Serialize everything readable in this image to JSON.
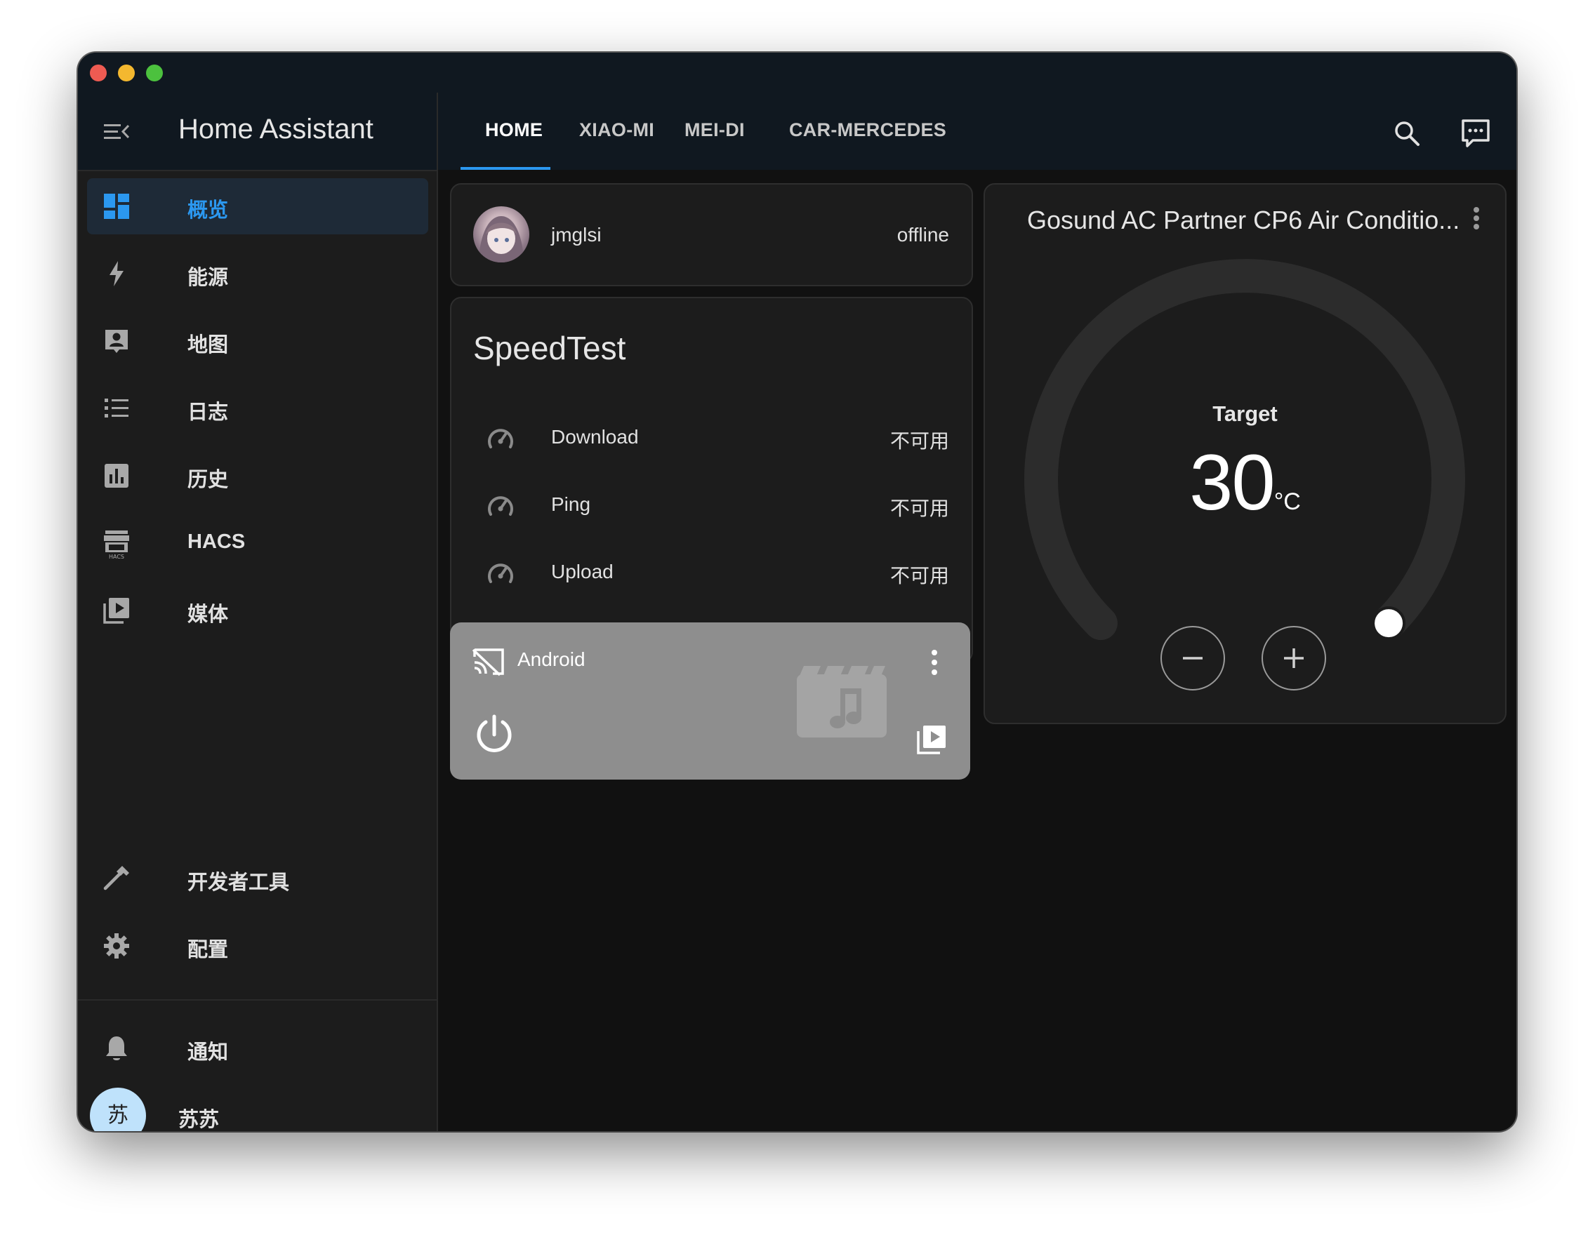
{
  "app": {
    "title": "Home Assistant"
  },
  "sidebar": {
    "items": [
      {
        "label": "概览",
        "icon": "view-dashboard-icon",
        "active": true
      },
      {
        "label": "能源",
        "icon": "lightning-bolt-icon"
      },
      {
        "label": "地图",
        "icon": "account-box-icon"
      },
      {
        "label": "日志",
        "icon": "format-list-bulleted-icon"
      },
      {
        "label": "历史",
        "icon": "chart-box-icon"
      },
      {
        "label": "HACS",
        "icon": "hacs-store-icon"
      },
      {
        "label": "媒体",
        "icon": "play-box-multiple-icon"
      }
    ],
    "bottom_items": [
      {
        "label": "开发者工具",
        "icon": "hammer-icon"
      },
      {
        "label": "配置",
        "icon": "cog-icon"
      }
    ],
    "notifications": {
      "label": "通知",
      "icon": "bell-icon"
    },
    "user": {
      "avatar_text": "苏",
      "name": "苏苏"
    }
  },
  "tabs": [
    {
      "label": "HOME",
      "active": true
    },
    {
      "label": "XIAO-MI"
    },
    {
      "label": "MEI-DI"
    },
    {
      "label": "CAR-MERCEDES"
    }
  ],
  "toolbar": {
    "icons": [
      "search-icon",
      "assist-icon",
      "overflow-menu-icon"
    ]
  },
  "person_card": {
    "name": "jmglsi",
    "state": "offline"
  },
  "speedtest": {
    "title": "SpeedTest",
    "rows": [
      {
        "name": "Download",
        "value": "不可用"
      },
      {
        "name": "Ping",
        "value": "不可用"
      },
      {
        "name": "Upload",
        "value": "不可用"
      }
    ]
  },
  "media_player": {
    "name": "Android",
    "background": "#8e8e8e"
  },
  "climate": {
    "title": "Gosund AC Partner CP6 Air Conditio...",
    "target_label": "Target",
    "target_value": "30",
    "unit": "°C",
    "dial_level": 1.0
  },
  "colors": {
    "accent": "#2b98f0",
    "card_bg": "#1c1c1c",
    "page_bg": "#111111",
    "header_bg": "#101820",
    "user_avatar_bg": "#bfe2fb"
  }
}
